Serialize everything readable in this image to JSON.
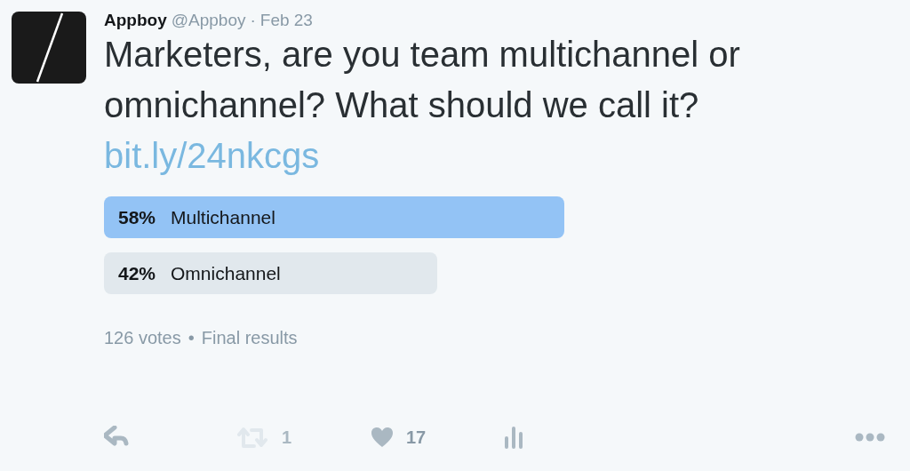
{
  "tweet": {
    "name": "Appboy",
    "handle": "@Appboy",
    "separator": "·",
    "date": "Feb 23",
    "text": "Marketers, are you team multichannel or omnichannel? What should we call it?",
    "link": "bit.ly/24nkcgs"
  },
  "poll": {
    "options": [
      {
        "percent": "58%",
        "label": "Multichannel",
        "selected": true
      },
      {
        "percent": "42%",
        "label": "Omnichannel",
        "selected": false
      }
    ],
    "votes": "126 votes",
    "bullet": "•",
    "status": "Final results"
  },
  "actions": [
    {
      "kind": "reply",
      "disabled": false
    },
    {
      "kind": "retweet",
      "count": "1",
      "disabled": true
    },
    {
      "kind": "like",
      "count": "17",
      "disabled": false
    },
    {
      "kind": "analytics",
      "disabled": false
    },
    {
      "kind": "more",
      "disabled": false
    }
  ]
}
